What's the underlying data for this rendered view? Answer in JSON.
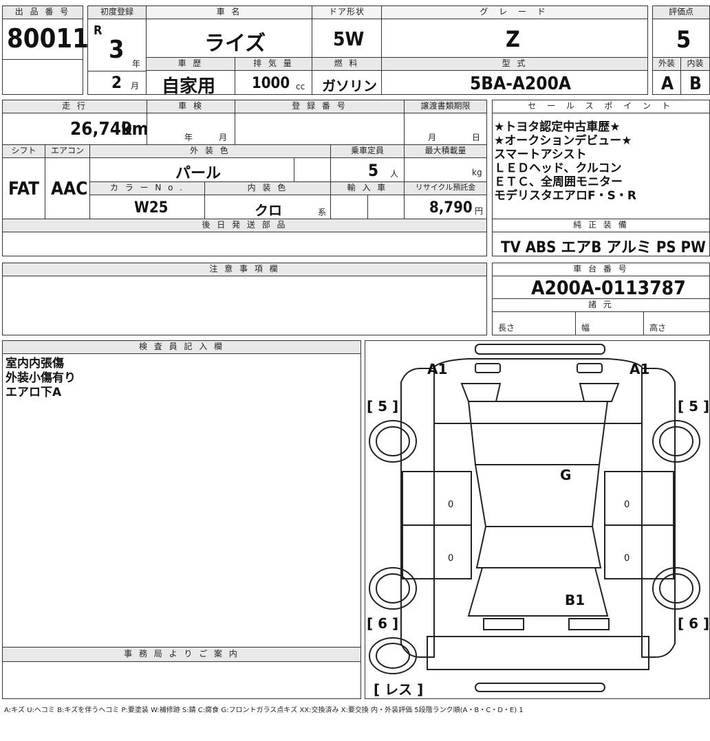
{
  "header": {
    "lot_label": "出 品 番 号",
    "lot_number": "80011",
    "first_reg_label": "初度登録",
    "era": "R",
    "year_value": "3",
    "year_unit": "年",
    "month_value": "2",
    "month_unit": "月",
    "car_name_label": "車 名",
    "car_name": "ライズ",
    "history_label": "車 歴",
    "history": "自家用",
    "displacement_label": "排 気 量",
    "displacement": "1000",
    "displacement_unit": "cc",
    "door_label": "ドア形状",
    "door": "5W",
    "fuel_label": "燃 料",
    "fuel": "ガソリン",
    "grade_label": "グ レ ー ド",
    "grade": "Z",
    "model_label": "型 式",
    "model": "5BA-A200A",
    "score_label": "評価点",
    "score": "5",
    "exterior_label": "外装",
    "interior_label": "内装",
    "exterior_grade": "A",
    "interior_grade": "B"
  },
  "details": {
    "mileage_label": "走 行",
    "mileage": "26,749",
    "mileage_unit": "km",
    "inspection_label": "車 検",
    "inspection_year": "年",
    "inspection_month": "月",
    "reg_number_label": "登 録 番 号",
    "transfer_label": "譲渡書類期限",
    "transfer_month": "月",
    "transfer_day": "日",
    "shift_label": "シフト",
    "shift": "FAT",
    "ac_label": "エアコン",
    "ac": "AAC",
    "ext_color_label": "外 装 色",
    "ext_color": "パール",
    "capacity_label": "乗車定員",
    "capacity": "5",
    "capacity_unit": "人",
    "max_load_label": "最大積載量",
    "max_load_unit": "kg",
    "color_no_label": "カ ラ ー N o .",
    "color_no": "W25",
    "int_color_label": "内 装 色",
    "int_color": "クロ",
    "int_color_suffix": "系",
    "import_label": "輸 入 車",
    "recycle_label": "リサイクル預託金",
    "recycle": "8,790",
    "recycle_unit": "円",
    "later_parts_label": "後 日 発 送 部 品"
  },
  "sales": {
    "label": "セ ー ル ス ポ イ ン ト",
    "lines": [
      "★トヨタ認定中古車歴★",
      "★オークションデビュー★",
      "スマートアシスト",
      "ＬＥＤヘッド、クルコン",
      "ＥＴＣ、全周囲モニター",
      "モデリスタエアロF・S・R"
    ],
    "equipment_label": "純 正 装 備",
    "equipment": "TV  ABS  エアB  アルミ  PS  PW"
  },
  "notes": {
    "caution_label": "注 意 事 項 欄",
    "chassis_label": "車 台 番 号",
    "chassis": "A200A-0113787",
    "spec_label": "諸 元",
    "length_label": "長さ",
    "width_label": "幅",
    "height_label": "高さ",
    "inspector_label": "検 査 員 記 入 欄",
    "inspector_text": "室内内張傷\n外装小傷有り\nエアロ下A",
    "office_label": "事 務 局 よ り ご 案 内"
  },
  "diagram": {
    "a1_left": "A1",
    "a1_right": "A1",
    "g": "G",
    "b1": "B1",
    "tire_fl": "[ 5 ]",
    "tire_fr": "[ 5 ]",
    "tire_rl": "[ 6 ]",
    "tire_rr": "[ 6 ]",
    "spare": "[ レス ]",
    "zero": "0"
  },
  "legend": "A:キズ  U:ヘコミ  B:キズを伴うヘコミ  P:要塗装  W:補修跡  S:錆  C:腐食  G:フロントガラス点キズ  XX:交換済み  X:要交換   内・外装評価  5段階ランク順(A・B・C・D・E)  1"
}
